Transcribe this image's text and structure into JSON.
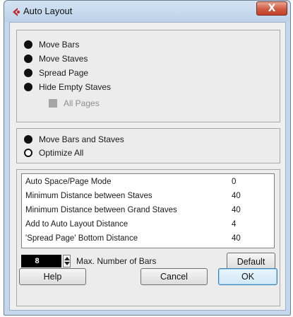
{
  "window": {
    "title": "Auto Layout",
    "close_label": "X"
  },
  "layout_options": [
    {
      "label": "Move Bars",
      "selected": true
    },
    {
      "label": "Move Staves",
      "selected": true
    },
    {
      "label": "Spread Page",
      "selected": true
    },
    {
      "label": "Hide Empty Staves",
      "selected": true
    }
  ],
  "all_pages": {
    "label": "All Pages",
    "enabled": false
  },
  "mode_options": [
    {
      "label": "Move Bars and Staves",
      "selected": true
    },
    {
      "label": "Optimize All",
      "selected": false
    }
  ],
  "settings_table": [
    {
      "label": "Auto Space/Page Mode",
      "value": "0"
    },
    {
      "label": "Minimum Distance between Staves",
      "value": "40"
    },
    {
      "label": "Minimum Distance between Grand Staves",
      "value": "40"
    },
    {
      "label": "Add to Auto Layout Distance",
      "value": "4"
    },
    {
      "label": "'Spread Page' Bottom Distance",
      "value": "40"
    }
  ],
  "max_bars": {
    "value": "8",
    "label": "Max. Number of Bars"
  },
  "buttons": {
    "default": "Default",
    "help": "Help",
    "cancel": "Cancel",
    "ok": "OK"
  },
  "colors": {
    "frame": "#c4d7ec",
    "close_button": "#cf5b42",
    "client_bg": "#efefef"
  }
}
